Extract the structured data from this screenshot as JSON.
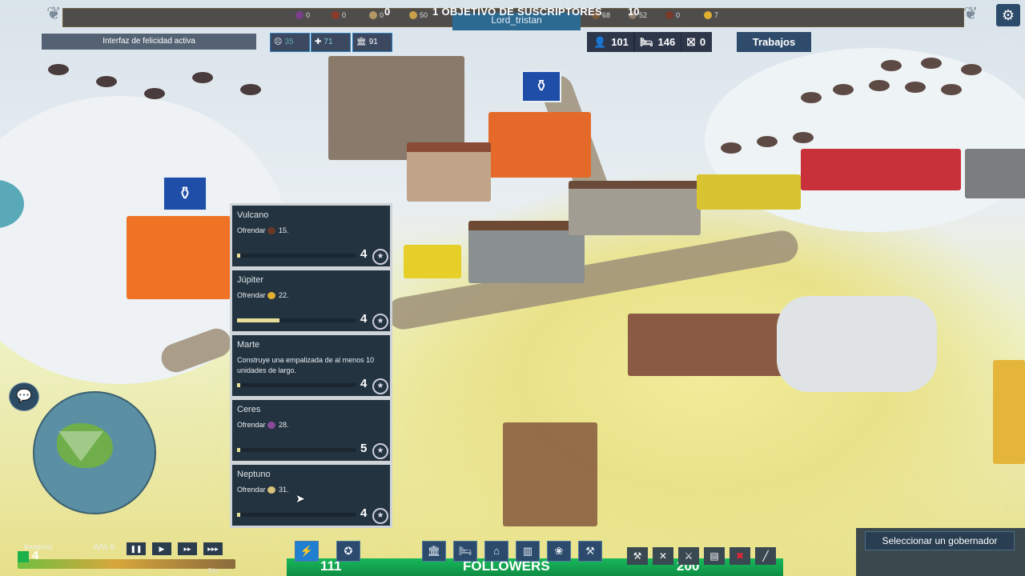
{
  "topbar": {
    "objective": "1 OBJETIVO DE SUSCRIPTORES",
    "objective_current": "0",
    "objective_target": "10",
    "username": "Lord_tristan",
    "resources_left": [
      {
        "icon": "grapes-icon",
        "value": "0",
        "color": "#7b3f8a"
      },
      {
        "icon": "meat-icon",
        "value": "0",
        "color": "#8c3a2a"
      },
      {
        "icon": "fish-icon",
        "value": "0",
        "color": "#b39766"
      },
      {
        "icon": "bread-icon",
        "value": "50",
        "color": "#c9a04a"
      }
    ],
    "resources_right": [
      {
        "icon": "wood-icon",
        "value": "68",
        "color": "#7b5a3a"
      },
      {
        "icon": "stone-icon",
        "value": "52",
        "color": "#8a7a6a"
      },
      {
        "icon": "pottery-icon",
        "value": "0",
        "color": "#7a3a2a"
      },
      {
        "icon": "coin-icon",
        "value": "7",
        "color": "#e0b030"
      }
    ]
  },
  "hud": {
    "happiness_label": "Interfaz de felicidad activa",
    "stat_happiness": "35",
    "stat_health": "71",
    "stat_civic": "91",
    "population": "101",
    "housing": "146",
    "jobless": "0",
    "jobs_button": "Trabajos",
    "version": "0.7.1781",
    "settings_icon": "gear-icon"
  },
  "gods": [
    {
      "name": "Vulcano",
      "desc_prefix": "Ofrendar",
      "desc_icon": "pottery-icon",
      "icon_color": "#6b3a25",
      "desc_value": "15.",
      "level": "4",
      "progress": 0.02
    },
    {
      "name": "Júpiter",
      "desc_prefix": "Ofrendar",
      "desc_icon": "coin-icon",
      "icon_color": "#e0b030",
      "desc_value": "22.",
      "level": "4",
      "progress": 0.36
    },
    {
      "name": "Marte",
      "desc_full": "Construye una empalizada de al menos 10 unidades de largo.",
      "level": "4",
      "progress": 0.02
    },
    {
      "name": "Ceres",
      "desc_prefix": "Ofrendar",
      "desc_icon": "grapes-icon",
      "icon_color": "#8a4a9a",
      "desc_value": "28.",
      "level": "5",
      "progress": 0.02
    },
    {
      "name": "Neptuno",
      "desc_prefix": "Ofrendar",
      "desc_icon": "fish-icon",
      "icon_color": "#d7c37a",
      "desc_value": "31.",
      "level": "4",
      "progress": 0.02
    }
  ],
  "time": {
    "season": "Invierno",
    "year": "Año 6",
    "day_label": "Día",
    "count": "4",
    "speed_buttons": [
      "pause",
      "play",
      "fast",
      "fastest"
    ]
  },
  "bottom": {
    "followers_label": "FOLLOWERS",
    "left_value": "111",
    "right_value": "200",
    "governor_button": "Seleccionar un gobernador"
  },
  "colors": {
    "accent_blue": "#2e4b6b",
    "followers_green": "#18b85a",
    "panel_dark": "#233340"
  }
}
